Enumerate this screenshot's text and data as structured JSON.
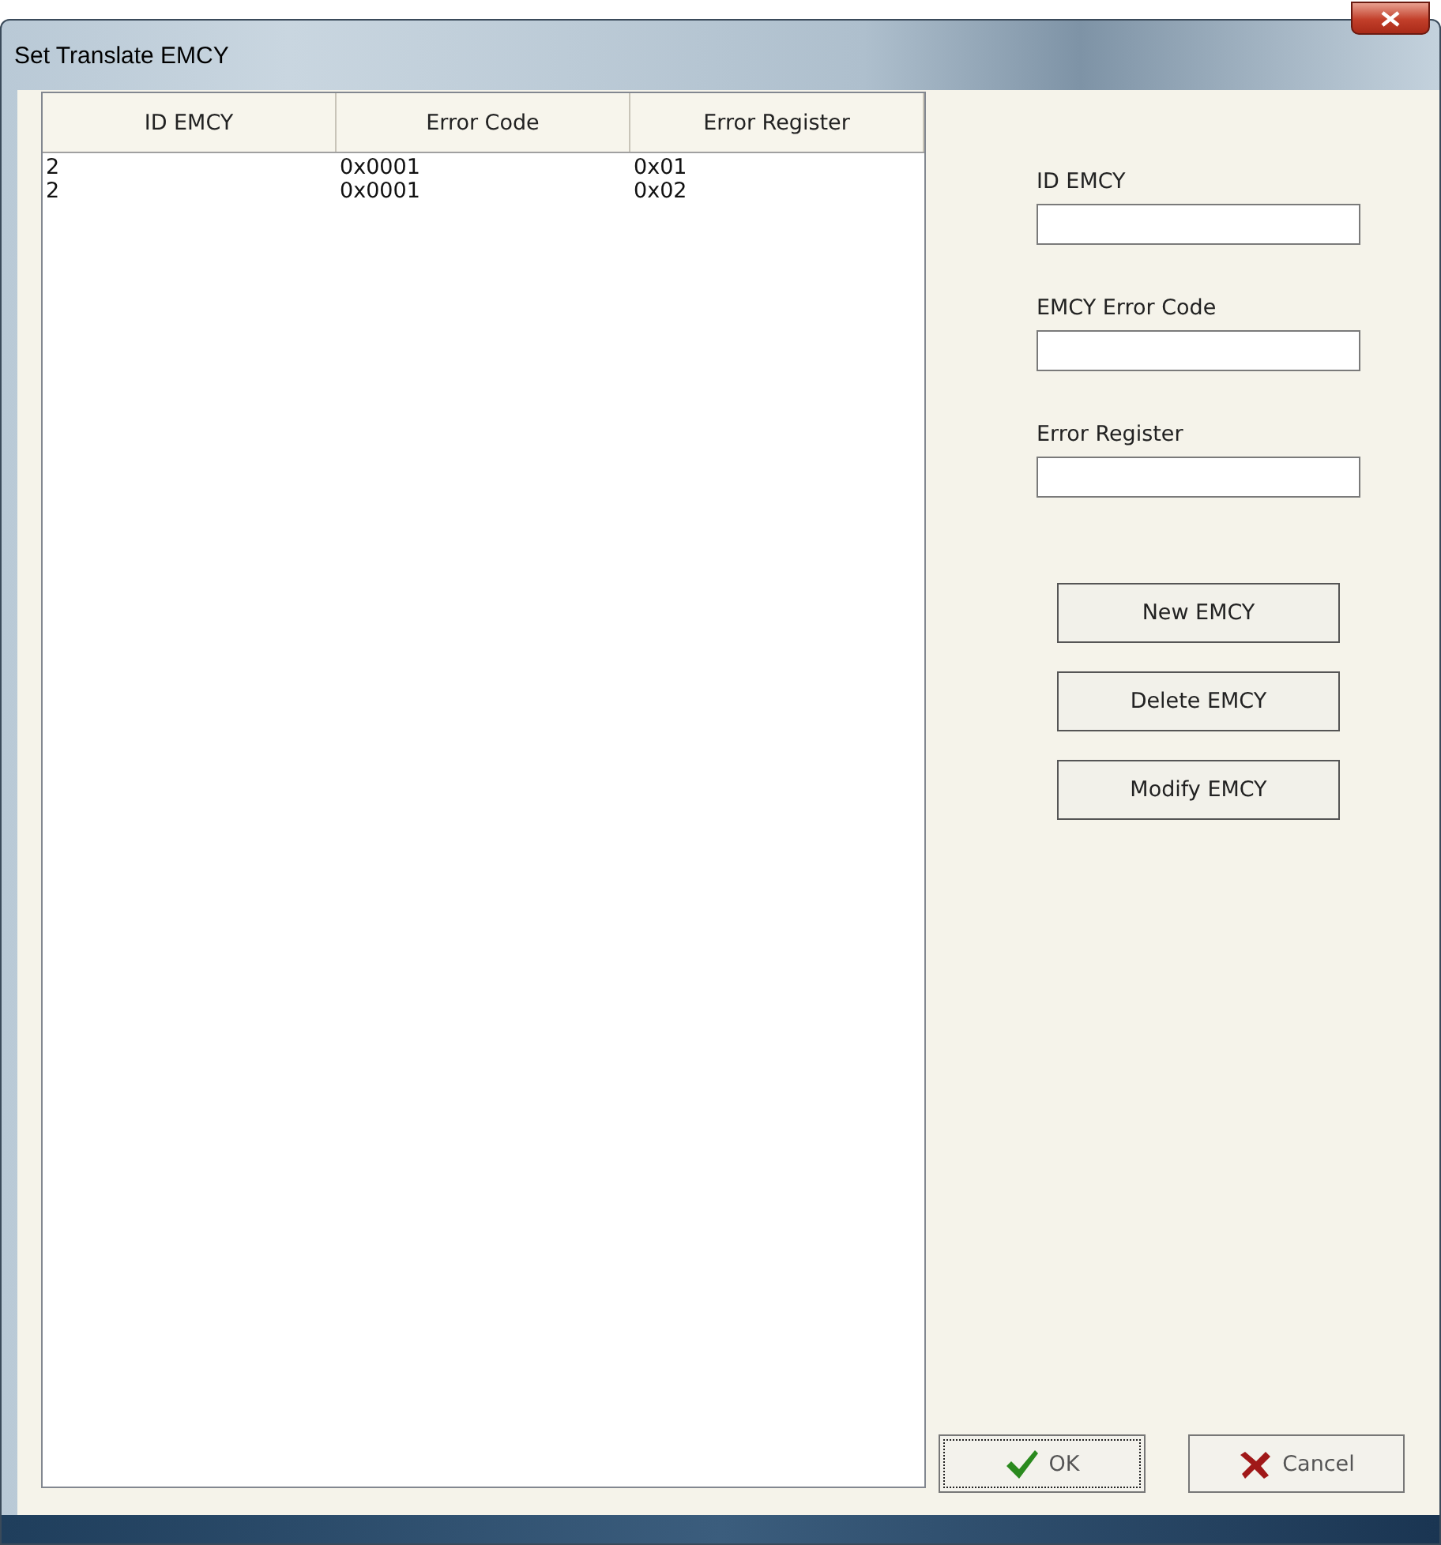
{
  "window": {
    "title": "Set Translate EMCY"
  },
  "table": {
    "columns": [
      "ID EMCY",
      "Error Code",
      "Error Register"
    ],
    "rows": [
      [
        "2",
        "0x0001",
        "0x01"
      ],
      [
        "2",
        "0x0001",
        "0x02"
      ]
    ]
  },
  "fields": [
    {
      "label": "ID EMCY"
    },
    {
      "label": "EMCY Error Code"
    },
    {
      "label": "Error Register"
    }
  ],
  "actions": [
    "New EMCY",
    "Delete EMCY",
    "Modify EMCY"
  ],
  "buttons": [
    {
      "label": "OK",
      "kind": "ok",
      "focused": true
    },
    {
      "label": "Cancel",
      "kind": "cancel",
      "focused": false
    }
  ]
}
